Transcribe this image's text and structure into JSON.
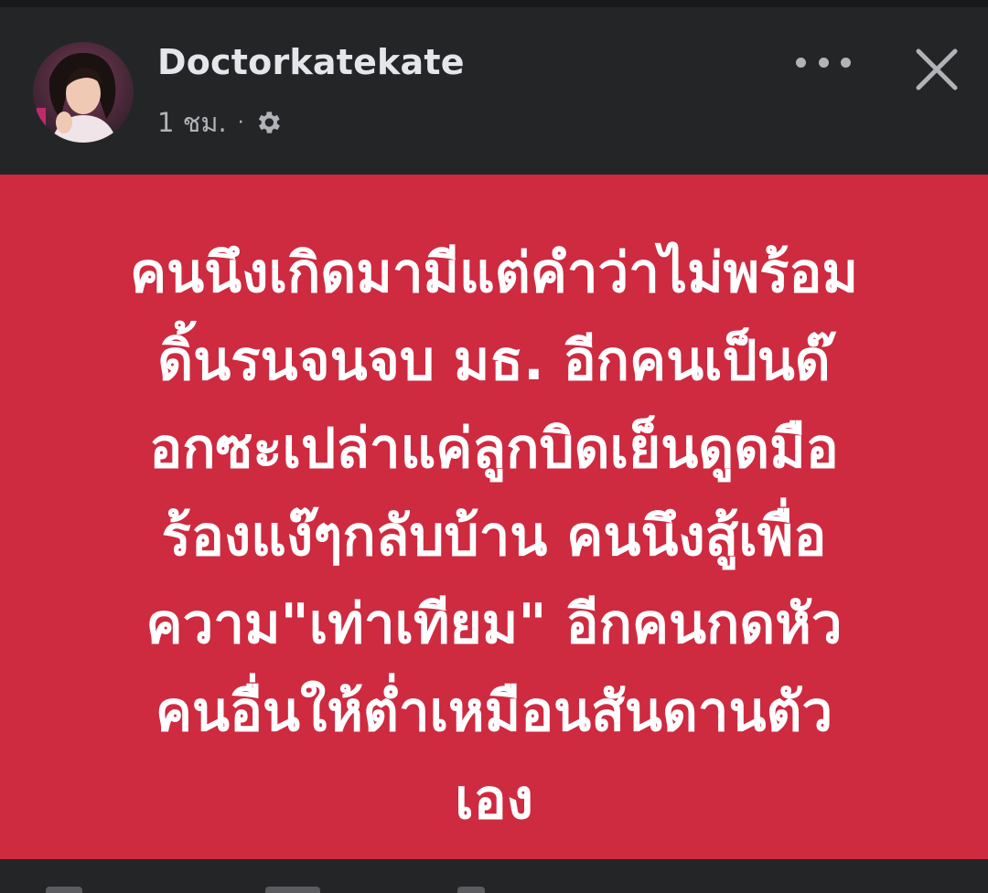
{
  "post": {
    "author": "Doctorkatekate",
    "time": "1 ชม.",
    "separator": "·",
    "privacy_icon": "gear-icon",
    "text": "คนนึงเกิดมามีแต่คำว่าไม่พร้อม\nดิ้นรนจนจบ มธ.  อีกคนเป็นด๊\nอกซะเปล่าแค่ลูกบิดเย็นดูดมือ\nร้องแง๊ๆกลับบ้าน คนนึงสู้เพื่อ\nความ\"เท่าเทียม\" อีกคนกดหัว\nคนอื่นให้ต่ำเหมือนสันดานตัว\nเอง",
    "background_color": "#ce2a40"
  },
  "actions": {
    "more_icon": "more-horizontal-icon",
    "close_icon": "close-icon"
  }
}
